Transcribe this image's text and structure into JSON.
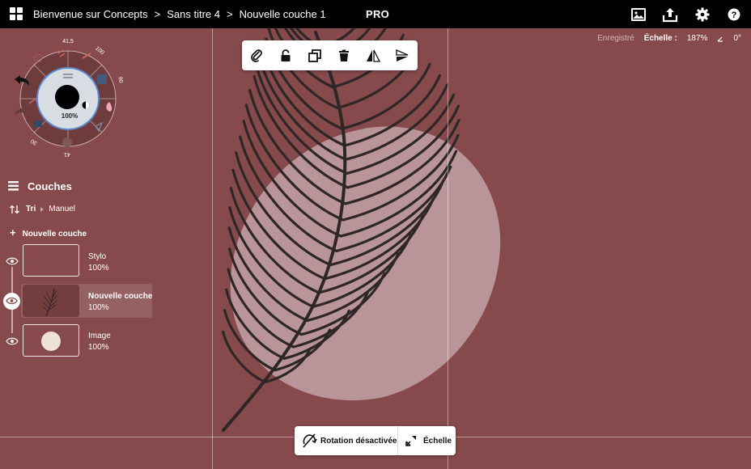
{
  "topbar": {
    "breadcrumbs": [
      "Bienvenue sur Concepts",
      "Sans titre 4",
      "Nouvelle couche 1"
    ],
    "separator": ">",
    "pro_label": "PRO"
  },
  "status": {
    "saved": "Enregistré",
    "scale_label": "Échelle :",
    "scale_value": "187%",
    "angle_value": "0°"
  },
  "wheel": {
    "size_top": "41,5",
    "size_right_top": "100",
    "size_right": "90",
    "size_bottom_left": "30",
    "size_bottom": "41",
    "opacity": "100%"
  },
  "layers": {
    "title": "Couches",
    "sort_label": "Tri",
    "sort_value": "Manuel",
    "new_layer_label": "Nouvelle couche",
    "items": [
      {
        "name": "Stylo",
        "opacity": "100%"
      },
      {
        "name": "Nouvelle couche",
        "opacity": "100%"
      },
      {
        "name": "Image",
        "opacity": "100%"
      }
    ]
  },
  "bottom": {
    "rotation_label": "Rotation désactivée",
    "scale_label": "Échelle"
  },
  "colors": {
    "canvas": "#864a4c",
    "circle": "#b99599",
    "feather": "#2e2627",
    "topbar": "#000000"
  }
}
